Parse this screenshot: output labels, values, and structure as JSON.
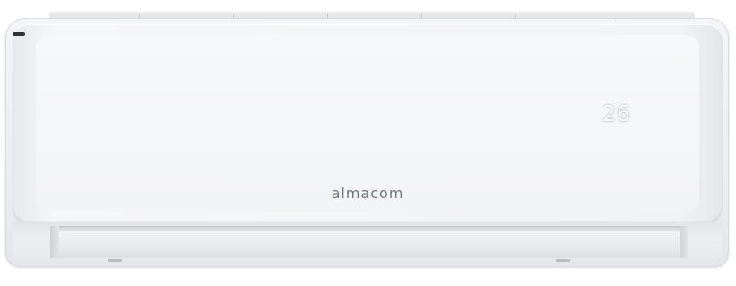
{
  "product": {
    "display_value": "26",
    "brand_name": "almacom",
    "body_color": "#f4f5f7",
    "brand_color": "#70767c",
    "display_color": "#ffffff"
  }
}
